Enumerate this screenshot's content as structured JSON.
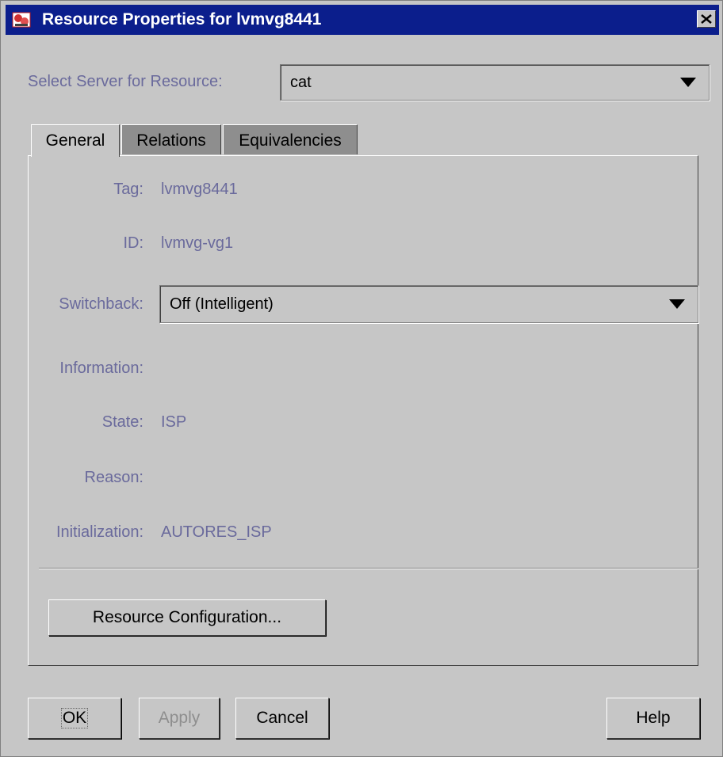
{
  "window": {
    "title": "Resource Properties for lvmvg8441"
  },
  "server": {
    "label": "Select Server for Resource:",
    "selected": "cat"
  },
  "tabs": [
    {
      "label": "General"
    },
    {
      "label": "Relations"
    },
    {
      "label": "Equivalencies"
    }
  ],
  "general": {
    "tag_label": "Tag:",
    "tag_value": "lvmvg8441",
    "id_label": "ID:",
    "id_value": "lvmvg-vg1",
    "switchback_label": "Switchback:",
    "switchback_selected": "Off (Intelligent)",
    "information_label": "Information:",
    "state_label": "State:",
    "state_value": "ISP",
    "reason_label": "Reason:",
    "initialization_label": "Initialization:",
    "initialization_value": "AUTORES_ISP",
    "resource_config_button": "Resource Configuration..."
  },
  "footer": {
    "ok": "OK",
    "apply": "Apply",
    "cancel": "Cancel",
    "help": "Help"
  },
  "colors": {
    "titlebar": "#0b1e8c",
    "window_bg": "#c6c6c6",
    "label_text": "#6a6a9c",
    "inactive_tab": "#8e8e8e"
  }
}
